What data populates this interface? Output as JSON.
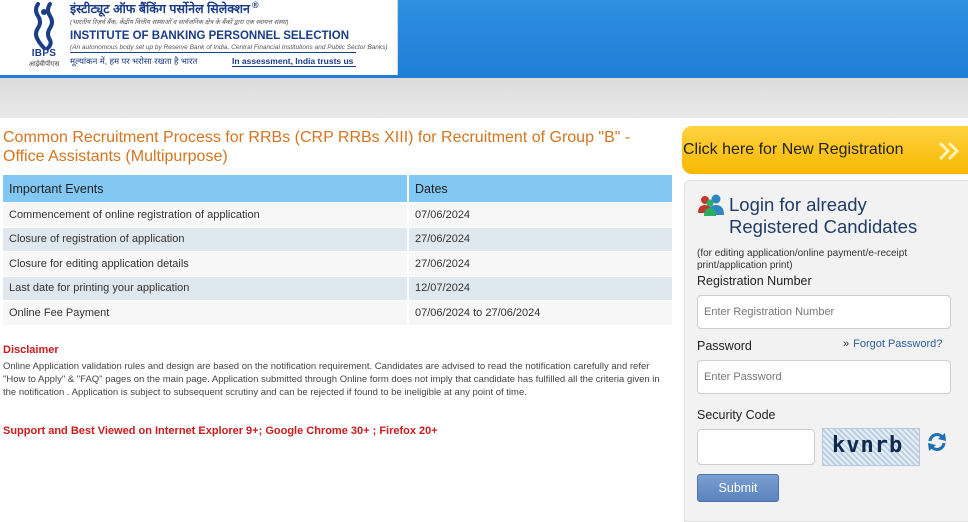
{
  "header": {
    "org_name_hindi": "इंस्टीट्यूट ऑफ बैंकिंग पर्सोनेल सिलेक्शन",
    "registered_mark": "®",
    "org_name_hindi_sub": "(भारतीय रिज़र्व बैंक, केंद्रीय वित्तीय संस्थाओं व सार्वजनिक क्षेत्र के बैंकों द्वारा एक स्वायत्त संस्था)",
    "org_name_english": "INSTITUTE OF BANKING PERSONNEL SELECTION",
    "org_name_english_sub": "(An autonomous body set up by Reserve Bank of India, Central Financial Institutions and Public Sector Banks)",
    "tagline_hindi": "मूल्यांकन में, हम पर भरोसा रखता है भारत",
    "tagline_english": "In assessment, India trusts us",
    "emblem_label": "IBPS",
    "emblem_sub": "आईबीपीएस",
    "brand_color": "#1b3c86"
  },
  "main": {
    "title": "Common Recruitment Process for RRBs (CRP RRBs XIII) for Recruitment of Group \"B\" - Office Assistants (Multipurpose)",
    "events_table": {
      "headers": [
        "Important Events",
        "Dates"
      ],
      "rows": [
        {
          "event": "Commencement of online registration of application",
          "date": "07/06/2024"
        },
        {
          "event": "Closure of registration of application",
          "date": "27/06/2024"
        },
        {
          "event": "Closure for editing application details",
          "date": "27/06/2024"
        },
        {
          "event": "Last date for printing your application",
          "date": "12/07/2024"
        },
        {
          "event": "Online Fee Payment",
          "date": "07/06/2024 to 27/06/2024"
        }
      ]
    },
    "disclaimer_title": "Disclaimer",
    "disclaimer_text": "Online Application validation rules and design are based on the notification requirement. Candidates are advised to read the notification carefully and refer \"How to Apply\" & \"FAQ\" pages on the main page. Application submitted through Online form does not imply that candidate has fulfilled all the criteria given in the notification . Application is subject to subsequent scrutiny and can be rejected if found to be ineligible at any point of time.",
    "support_text": "Support and Best Viewed on Internet Explorer 9+; Google Chrome 30+ ; Firefox 20+"
  },
  "sidebar": {
    "new_registration_label": "Click here for New Registration",
    "login_title": "Login for already Registered Candidates",
    "login_note": "(for editing application/online payment/e-receipt print/application print)",
    "registration_number_label": "Registration Number",
    "registration_number_placeholder": "Enter Registration Number",
    "password_label": "Password",
    "password_placeholder": "Enter Password",
    "forgot_password_label": "Forgot Password?",
    "security_code_label": "Security Code",
    "captcha_text": "kvnrb",
    "submit_label": "Submit"
  },
  "colors": {
    "accent_orange": "#d4751f",
    "header_blue": "#1f7ed6",
    "table_header": "#82c8f2",
    "disclaimer_red": "#cc1b1b",
    "button_yellow": "#f7b900",
    "submit_blue": "#5a82bd"
  },
  "icons": {
    "emblem": "ibps-emblem-icon",
    "new_registration_arrow": "double-chevron-right-icon",
    "login": "users-icon",
    "forgot_chevron": "double-chevron-right-icon",
    "refresh": "refresh-icon"
  }
}
